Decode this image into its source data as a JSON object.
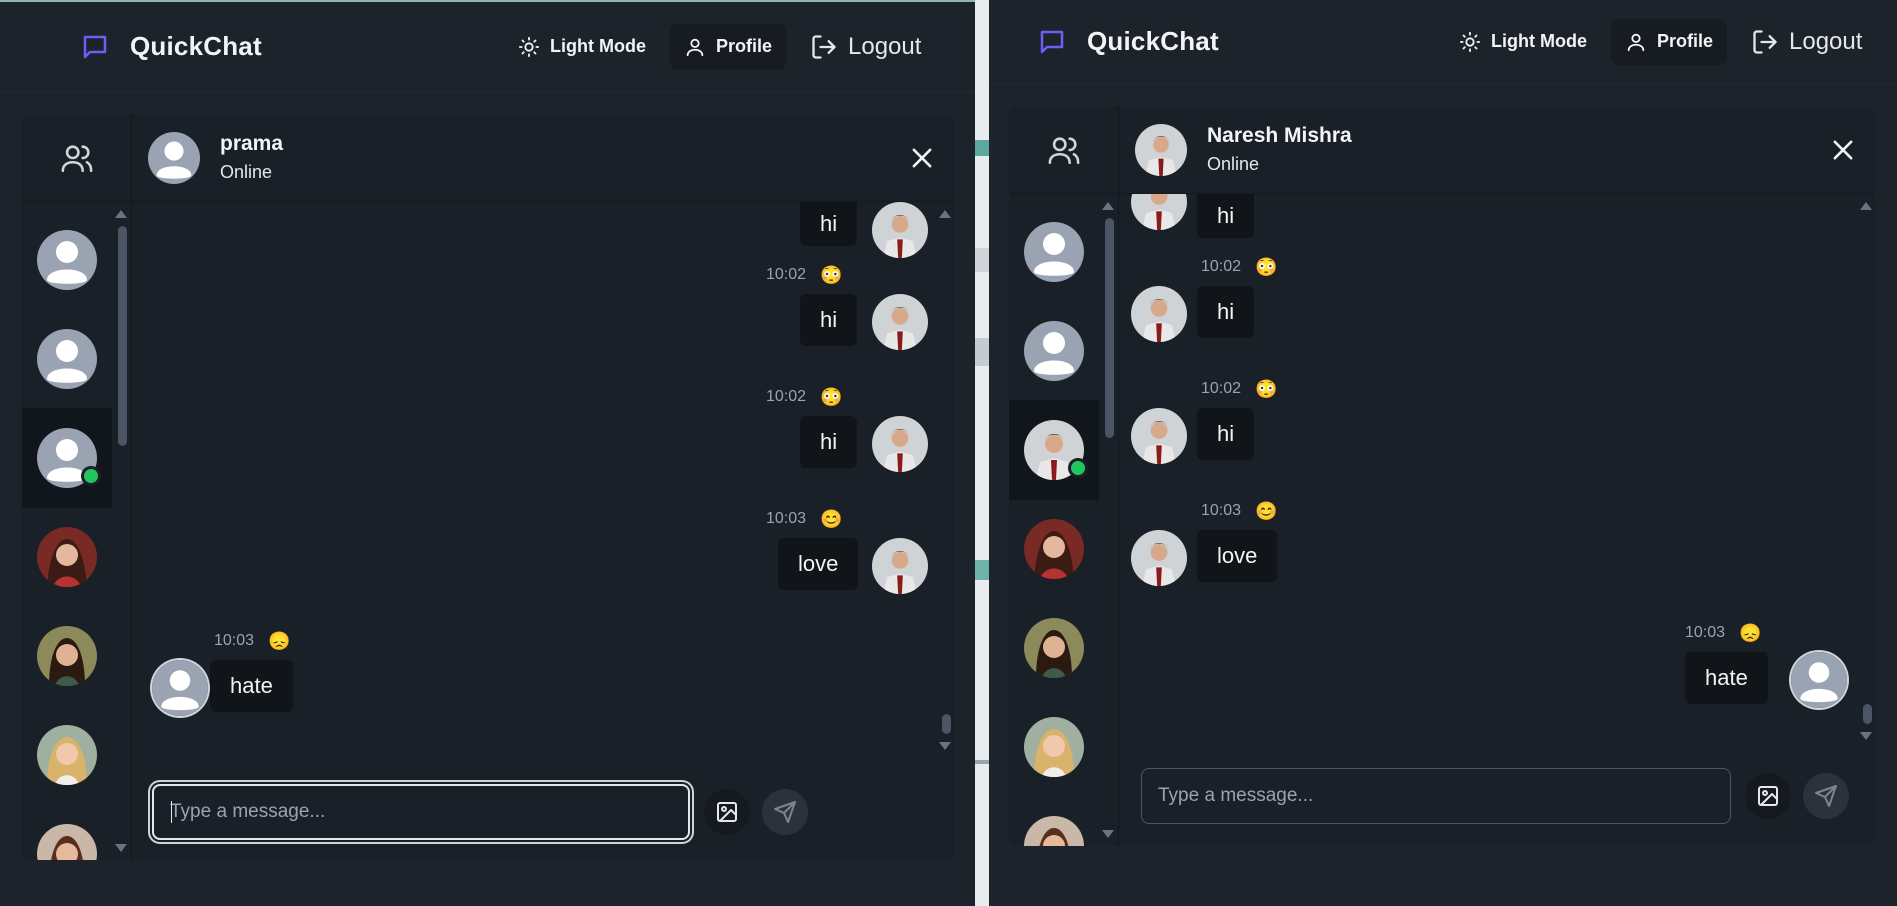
{
  "left": {
    "app_name": "QuickChat",
    "nav": {
      "light_mode": "Light Mode",
      "profile": "Profile",
      "logout": "Logout"
    },
    "chat": {
      "name": "prama",
      "status": "Online"
    },
    "messages": [
      {
        "text": "hi",
        "time": "",
        "emoji": "",
        "side": "right"
      },
      {
        "text": "hi",
        "time": "10:02",
        "emoji": "😳",
        "side": "right"
      },
      {
        "text": "hi",
        "time": "10:02",
        "emoji": "😳",
        "side": "right"
      },
      {
        "text": "love",
        "time": "10:03",
        "emoji": "😊",
        "side": "right"
      },
      {
        "text": "hate",
        "time": "10:03",
        "emoji": "😞",
        "side": "left"
      }
    ],
    "input": {
      "placeholder": "Type a message...",
      "value": ""
    }
  },
  "right": {
    "app_name": "QuickChat",
    "nav": {
      "light_mode": "Light Mode",
      "profile": "Profile",
      "logout": "Logout"
    },
    "chat": {
      "name": "Naresh Mishra",
      "status": "Online"
    },
    "messages": [
      {
        "text": "hi",
        "time": "",
        "emoji": "",
        "side": "left"
      },
      {
        "text": "hi",
        "time": "10:02",
        "emoji": "😳",
        "side": "left"
      },
      {
        "text": "hi",
        "time": "10:02",
        "emoji": "😳",
        "side": "left"
      },
      {
        "text": "love",
        "time": "10:03",
        "emoji": "😊",
        "side": "left"
      },
      {
        "text": "hate",
        "time": "10:03",
        "emoji": "😞",
        "side": "right"
      }
    ],
    "input": {
      "placeholder": "Type a message...",
      "value": ""
    }
  },
  "icons": {
    "brand": "chat-bubble-icon",
    "light_mode": "sun-icon",
    "profile": "user-icon",
    "logout": "logout-icon",
    "contacts": "users-icon",
    "close": "close-icon",
    "image": "image-icon",
    "send": "send-icon"
  },
  "colors": {
    "background": "#1d232a",
    "panel": "#1a2028",
    "bubble": "#11151a",
    "brand_accent": "#6d5ff6",
    "online": "#22c55e"
  }
}
